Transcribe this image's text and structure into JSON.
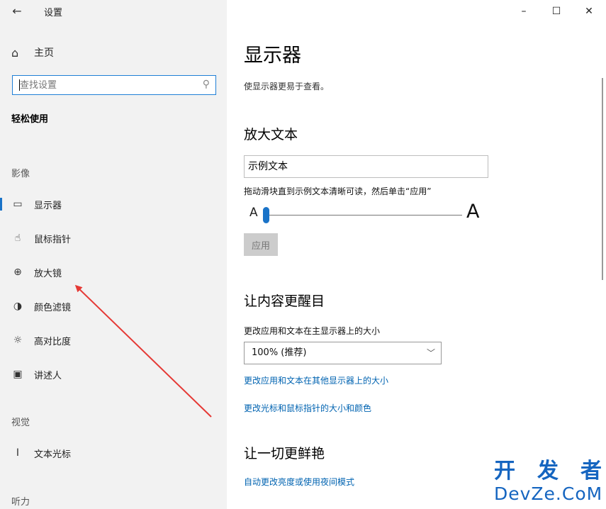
{
  "app": {
    "title": "设置",
    "back_icon": "←"
  },
  "window_controls": {
    "minimize": "–",
    "maximize": "☐",
    "close": "✕"
  },
  "sidebar": {
    "home_label": "主页",
    "home_icon": "⌂",
    "search_placeholder": "查找设置",
    "search_icon": "⚲",
    "category": "轻松使用",
    "sections": [
      {
        "header": "影像",
        "items": [
          {
            "label": "显示器",
            "icon": "▭",
            "active": true
          },
          {
            "label": "鼠标指针",
            "icon": "☝",
            "active": false
          },
          {
            "label": "放大镜",
            "icon": "⊕",
            "active": false
          },
          {
            "label": "颜色滤镜",
            "icon": "◑",
            "active": false
          },
          {
            "label": "高对比度",
            "icon": "☼",
            "active": false
          },
          {
            "label": "讲述人",
            "icon": "▣",
            "active": false
          }
        ]
      },
      {
        "header": "视觉",
        "items": [
          {
            "label": "文本光标",
            "icon": "I",
            "active": false
          }
        ]
      },
      {
        "header": "听力",
        "items": []
      }
    ]
  },
  "main": {
    "title": "显示器",
    "description": "使显示器更易于查看。",
    "enlarge_text": {
      "heading": "放大文本",
      "sample_text": "示例文本",
      "hint": "拖动滑块直到示例文本清晰可读，然后单击“应用”",
      "small_a": "A",
      "big_a": "A",
      "slider_value": 0,
      "apply_label": "应用"
    },
    "make_bigger": {
      "heading": "让内容更醒目",
      "size_label": "更改应用和文本在主显示器上的大小",
      "size_value": "100% (推荐)",
      "chevron": "﹀",
      "link1": "更改应用和文本在其他显示器上的大小",
      "link2": "更改光标和鼠标指针的大小和颜色"
    },
    "brighter": {
      "heading": "让一切更鲜艳",
      "link1": "自动更改亮度或使用夜间模式"
    }
  },
  "watermark": {
    "chars": [
      "开",
      "发",
      "者"
    ],
    "domain": "DevZe.CoM"
  },
  "colors": {
    "accent": "#1a73c8",
    "link": "#0063b1",
    "annotation_arrow": "#e53935"
  }
}
